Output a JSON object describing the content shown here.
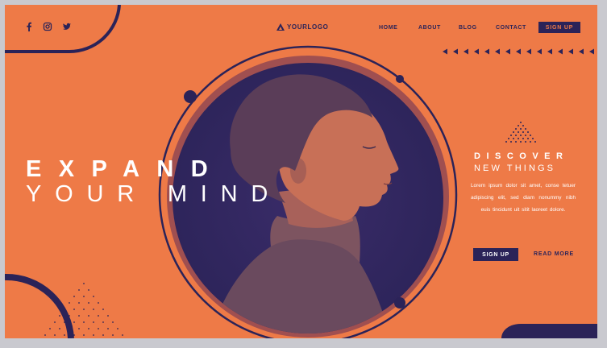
{
  "colors": {
    "background": "#ee7a47",
    "primary": "#2b2358",
    "accent_light": "#ffffff",
    "ring": "#a04f50"
  },
  "social": [
    {
      "icon": "facebook-icon"
    },
    {
      "icon": "instagram-icon"
    },
    {
      "icon": "twitter-icon"
    }
  ],
  "logo": {
    "text": "YOURLOGO",
    "icon": "triangle-logo-icon"
  },
  "nav": {
    "items": [
      "HOME",
      "ABOUT",
      "BLOG",
      "CONTACT"
    ],
    "signup_label": "SIGN UP"
  },
  "hero": {
    "line1": "EXPAND",
    "line2": "YOUR MIND",
    "image": "profile-portrait-duotone"
  },
  "discover": {
    "title": "DISCOVER",
    "subtitle": "NEW THINGS",
    "body": "Lorem ipsum dolor sit amet, conse tetuer adipiscing elit, sed diam nonummy nibh euis tincidunt uit sitit laoreet dolore.",
    "signup_label": "SIGN UP",
    "readmore_label": "READ MORE"
  }
}
